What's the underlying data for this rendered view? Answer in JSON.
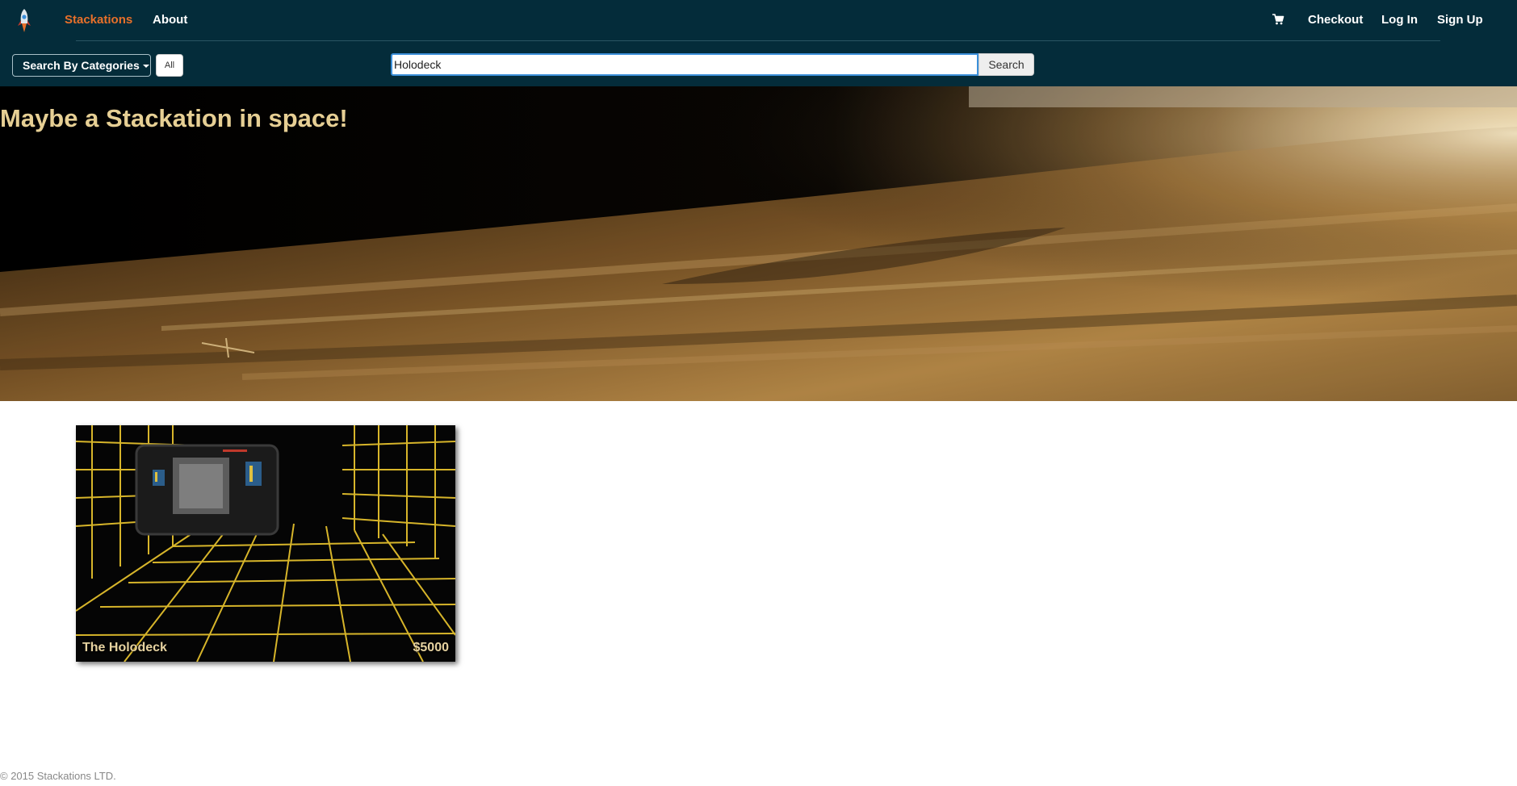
{
  "nav": {
    "brand": "Stackations",
    "about": "About",
    "checkout": "Checkout",
    "login": "Log In",
    "signup": "Sign Up",
    "cart_icon": "shopping-cart-icon",
    "logo_icon": "rocket-icon"
  },
  "search": {
    "category_button": "Search By Categories",
    "all_button": "All",
    "query": "Holodeck",
    "button": "Search"
  },
  "hero": {
    "title": "Maybe a Stackation in space!"
  },
  "results": [
    {
      "name": "The Holodeck",
      "price": "$5000"
    }
  ],
  "footer": {
    "copyright": "© 2015 Stackations LTD."
  },
  "colors": {
    "navbar_bg": "#042c3a",
    "brand_accent": "#e8702a",
    "hero_title": "#e6cf94",
    "search_focus": "#3b8fd9",
    "grid_line": "#d7b52a"
  }
}
